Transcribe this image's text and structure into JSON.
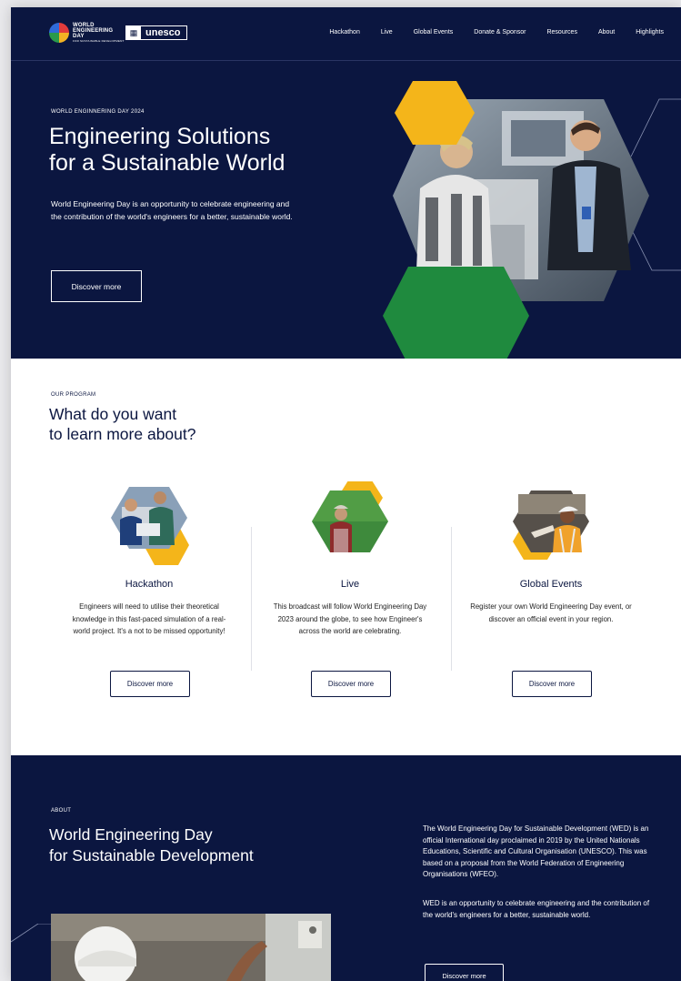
{
  "nav": {
    "brand": "WORLD ENGINEERING DAY",
    "brand_sub": "FOR SUSTAINABLE DEVELOPMENT",
    "partner": "unesco",
    "links": [
      "Hackathon",
      "Live",
      "Global Events",
      "Donate & Sponsor",
      "Resources",
      "About",
      "Highlights"
    ]
  },
  "hero": {
    "eyebrow": "WORLD ENGINNERING DAY 2024",
    "title_line1": "Engineering Solutions",
    "title_line2": "for a Sustainable World",
    "description": "World Engineering Day is an opportunity to celebrate engineering and the contribution of the world's engineers for a better, sustainable world.",
    "cta": "Discover more"
  },
  "program": {
    "eyebrow": "OUR PROGRAM",
    "title_line1": "What do you want",
    "title_line2": "to learn more about?",
    "cards": [
      {
        "title": "Hackathon",
        "description": "Engineers will need to utilise their theoretical knowledge in this fast-paced simulation of a real-world project. It's a not to be missed opportunity!",
        "cta": "Discover more"
      },
      {
        "title": "Live",
        "description": "This broadcast will follow World Engineering Day 2023 around the globe, to see how Engineer's across the world are celebrating.",
        "cta": "Discover more"
      },
      {
        "title": "Global Events",
        "description": "Register your own World Engineering Day event, or discover an official event in your region.",
        "cta": "Discover more"
      }
    ]
  },
  "about": {
    "eyebrow": "ABOUT",
    "title_line1": "World Engineering Day",
    "title_line2": "for Sustainable Development",
    "paragraph1": "The World Engineering Day for Sustainable Development (WED) is an official International day proclaimed in 2019 by the United Nationals Educations, Scientific and Cultural Organisation (UNESCO). This was based on a proposal from the World Federation of Engineering Organisations (WFEO).",
    "paragraph2": "WED is an opportunity to celebrate engineering and the contribution of the world's engineers for a better, sustainable world.",
    "cta": "Discover more"
  },
  "colors": {
    "navy": "#0b1640",
    "yellow": "#f4b51a",
    "green": "#1f8a3e"
  }
}
